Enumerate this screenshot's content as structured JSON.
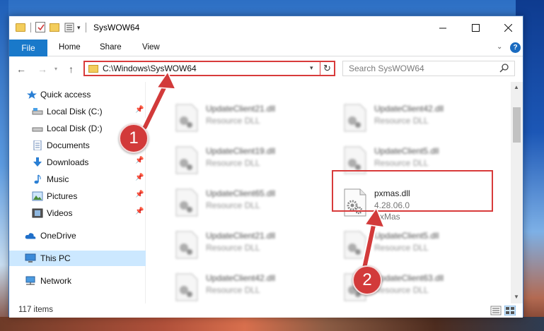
{
  "window": {
    "title": "SysWOW64"
  },
  "ribbon": {
    "tabs": [
      {
        "label": "File"
      },
      {
        "label": "Home"
      },
      {
        "label": "Share"
      },
      {
        "label": "View"
      }
    ]
  },
  "address_bar": {
    "path": "C:\\Windows\\SysWOW64"
  },
  "search": {
    "placeholder": "Search SysWOW64"
  },
  "sidebar": {
    "items": [
      {
        "label": "Quick access",
        "icon": "star-icon"
      },
      {
        "label": "Local Disk (C:)",
        "icon": "drive-icon",
        "pinned": true
      },
      {
        "label": "Local Disk (D:)",
        "icon": "drive-icon"
      },
      {
        "label": "Documents",
        "icon": "documents-icon",
        "pinned": true
      },
      {
        "label": "Downloads",
        "icon": "download-icon",
        "pinned": true
      },
      {
        "label": "Music",
        "icon": "music-icon",
        "pinned": true
      },
      {
        "label": "Pictures",
        "icon": "pictures-icon",
        "pinned": true
      },
      {
        "label": "Videos",
        "icon": "videos-icon",
        "pinned": true
      },
      {
        "label": "OneDrive",
        "icon": "cloud-icon"
      },
      {
        "label": "This PC",
        "icon": "computer-icon",
        "selected": true
      },
      {
        "label": "Network",
        "icon": "network-icon"
      }
    ]
  },
  "files": [
    {
      "name": "UpdateClient21.dll",
      "type": "Resource DLL",
      "blurred": true
    },
    {
      "name": "UpdateClient42.dll",
      "type": "Resource DLL",
      "blurred": true
    },
    {
      "name": "UpdateClient19.dll",
      "type": "Resource DLL",
      "blurred": true
    },
    {
      "name": "UpdateClient5.dll",
      "type": "Resource DLL",
      "blurred": true
    },
    {
      "name": "UpdateClient65.dll",
      "type": "Resource DLL",
      "blurred": true
    },
    {
      "name": "pxmas.dll",
      "version": "4.28.06.0",
      "description": "PxMas",
      "highlighted": true
    },
    {
      "name": "UpdateClient21.dll",
      "type": "Resource DLL",
      "blurred": true
    },
    {
      "name": "UpdateClient5.dll",
      "type": "Resource DLL",
      "blurred": true
    },
    {
      "name": "UpdateClient42.dll",
      "type": "Resource DLL",
      "blurred": true
    },
    {
      "name": "UpdateClient63.dll",
      "type": "Resource DLL",
      "blurred": true
    }
  ],
  "status": {
    "item_count": "117 items"
  },
  "callouts": [
    {
      "number": "1"
    },
    {
      "number": "2"
    }
  ],
  "colors": {
    "accent": "#1979ca",
    "highlight_red": "#d83b3b",
    "selection": "#cce8ff"
  }
}
